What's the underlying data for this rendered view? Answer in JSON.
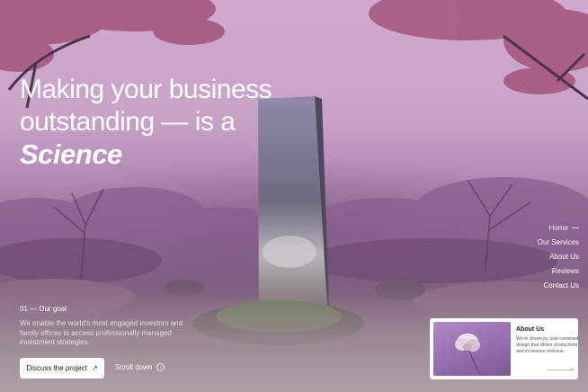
{
  "hero": {
    "headline_line1": "Making your business",
    "headline_line2": "outstanding — is a",
    "headline_emphasis": "Science"
  },
  "nav": {
    "items": [
      {
        "label": "Home",
        "active": true
      },
      {
        "label": "Our Services"
      },
      {
        "label": "About Us"
      },
      {
        "label": "Reviews"
      },
      {
        "label": "Contact Us"
      }
    ]
  },
  "goal": {
    "title": "01 — Our goal",
    "text": "We enable the world's most engaged investors and family offices to access professionally managed investment strategies."
  },
  "actions": {
    "discuss_label": "Discuss the project",
    "scroll_label": "Scroll down"
  },
  "about_card": {
    "title": "About Us",
    "text": "We're driven by user-centered design that drives productivity and increases revenue."
  },
  "colors": {
    "sky": "#cfa9cf",
    "foliage": "#a8587f",
    "card_bg": "#ffffff"
  }
}
